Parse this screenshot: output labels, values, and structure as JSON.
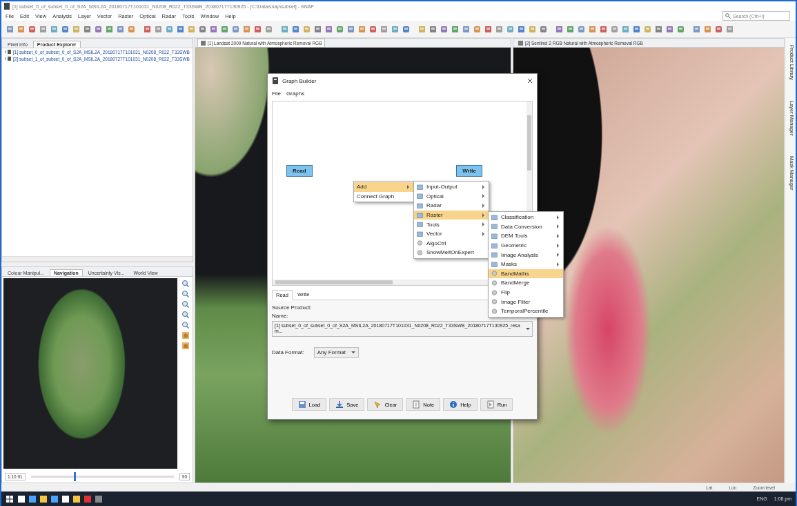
{
  "window": {
    "title": "[1] subset_0_of_subset_0_of_S2A_MSIL2A_20180717T101031_N0208_R022_T33SWB_20180717T130925 - [C:\\Data\\snap\\subset] - SNAP"
  },
  "menu": [
    "File",
    "Edit",
    "View",
    "Analysis",
    "Layer",
    "Vector",
    "Raster",
    "Optical",
    "Radar",
    "Tools",
    "Window",
    "Help"
  ],
  "search": {
    "placeholder": "Search (Ctrl+I)"
  },
  "left_panel": {
    "tabs": [
      {
        "label": "Pixel Info",
        "selected": false
      },
      {
        "label": "Product Explorer",
        "selected": true
      }
    ],
    "products": [
      "[1] subset_0_of_subset_0_of_S2A_MSIL2A_20180717T101031_N0208_R022_T33SWB",
      "[2] subset_1_of_subset_0_of_S2A_MSIL2A_20180727T101031_N0208_R022_T33SWB"
    ]
  },
  "navigation_panel": {
    "tabs": [
      {
        "label": "Colour Manipul...",
        "selected": false
      },
      {
        "label": "Navigation",
        "selected": true
      },
      {
        "label": "Uncertainty Vis...",
        "selected": false
      },
      {
        "label": "World View",
        "selected": false
      }
    ],
    "scale": "1:10.91",
    "level": 0.3,
    "zoom_value": "90"
  },
  "image_views": [
    {
      "title": "[1] Landsat 2009 Natural with Atmospheric Removal RGB",
      "selected": true
    },
    {
      "title": "[2] Sentinel 2 RGB Natural with Atmospheric Removal RGB",
      "selected": false
    }
  ],
  "side_tabs": [
    "Product Library",
    "Layer Manager",
    "Mask Manager"
  ],
  "graph_builder": {
    "title": "Graph Builder",
    "menu": [
      "File",
      "Graphs"
    ],
    "nodes": [
      {
        "label": "Read"
      },
      {
        "label": "Write"
      }
    ],
    "tabs": [
      {
        "label": "Read",
        "selected": true
      },
      {
        "label": "Write",
        "selected": false
      }
    ],
    "source_label": "Source Product:",
    "name_label": "Name:",
    "name_value": "[1] subset_0_of_subset_0_of_S2A_MSIL2A_20180717T101031_N0208_R022_T33SWB_20180717T130925_resam...",
    "format_label": "Data Format:",
    "format_value": "Any Format",
    "buttons": [
      "Load",
      "Save",
      "Clear",
      "Note",
      "Help",
      "Run"
    ]
  },
  "context_menu": [
    {
      "label": "Add",
      "submenu": true,
      "selected": true
    },
    {
      "label": "Connect Graph",
      "submenu": false,
      "selected": false
    }
  ],
  "add_menu": [
    {
      "label": "Input-Output",
      "submenu": true,
      "selected": false
    },
    {
      "label": "Optical",
      "submenu": true,
      "selected": false
    },
    {
      "label": "Radar",
      "submenu": true,
      "selected": false
    },
    {
      "label": "Raster",
      "submenu": true,
      "selected": true
    },
    {
      "label": "Tools",
      "submenu": true,
      "selected": false
    },
    {
      "label": "Vector",
      "submenu": true,
      "selected": false
    },
    {
      "label": "AlgoCtrl",
      "submenu": false,
      "selected": false
    },
    {
      "label": "SnowMeltOnExpert",
      "submenu": false,
      "selected": false
    }
  ],
  "raster_menu": [
    {
      "label": "Classification",
      "submenu": true,
      "selected": false
    },
    {
      "label": "Data Conversion",
      "submenu": true,
      "selected": false
    },
    {
      "label": "DEM Tools",
      "submenu": true,
      "selected": false
    },
    {
      "label": "Geometric",
      "submenu": true,
      "selected": false
    },
    {
      "label": "Image Analysis",
      "submenu": true,
      "selected": false
    },
    {
      "label": "Masks",
      "submenu": true,
      "selected": false
    },
    {
      "label": "BandMaths",
      "submenu": false,
      "selected": true
    },
    {
      "label": "BandMerge",
      "submenu": false,
      "selected": false
    },
    {
      "label": "Flip",
      "submenu": false,
      "selected": false
    },
    {
      "label": "Image Filter",
      "submenu": false,
      "selected": false
    },
    {
      "label": "TemporalPercentile",
      "submenu": false,
      "selected": false
    }
  ],
  "status_bar": [
    "Lat",
    "Lon",
    "Zoom level"
  ],
  "taskbar": {
    "language": "ENG",
    "time": "1:08 pm"
  }
}
